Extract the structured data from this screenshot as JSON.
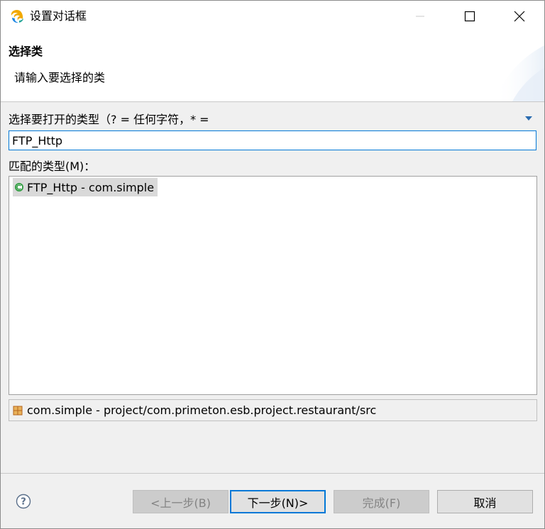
{
  "window": {
    "title": "设置对话框"
  },
  "banner": {
    "title": "选择类",
    "message": "请输入要选择的类"
  },
  "search": {
    "label": "选择要打开的类型（? = 任何字符，* =",
    "value": "FTP_Http"
  },
  "matches": {
    "label": "匹配的类型(M)：",
    "items": [
      {
        "text": "FTP_Http - com.simple",
        "icon": "class-icon"
      }
    ]
  },
  "package": {
    "text": "com.simple - project/com.primeton.esb.project.restaurant/src",
    "icon": "package-icon"
  },
  "buttons": {
    "back": "<上一步(B)",
    "next": "下一步(N)>",
    "finish": "完成(F)",
    "cancel": "取消"
  },
  "colors": {
    "accent": "#0078d7",
    "selection": "#d9d9d9",
    "class_icon": "#2e9b3f",
    "package_icon": "#b5651d"
  }
}
